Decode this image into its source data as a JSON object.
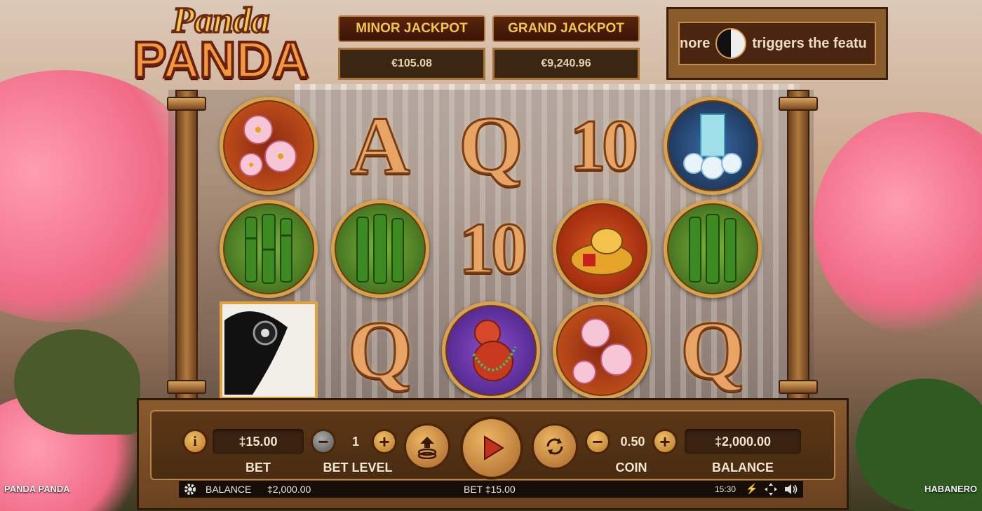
{
  "game": {
    "logo_line1": "Panda",
    "logo_line2": "PANDA",
    "corner_title": "PANDA PANDA",
    "provider": "HABANERO"
  },
  "jackpots": {
    "minor": {
      "label": "MINOR JACKPOT",
      "value": "€105.08"
    },
    "grand": {
      "label": "GRAND JACKPOT",
      "value": "€9,240.96"
    }
  },
  "info_ticker": {
    "text_before": "nore",
    "text_after": "triggers the featu",
    "icon": "yin-yang-panda-icon"
  },
  "reels": [
    [
      "cherry-blossom",
      "bamboo",
      "panda"
    ],
    [
      "A",
      "bamboo",
      "Q"
    ],
    [
      "Q",
      "10",
      "gourd"
    ],
    [
      "10",
      "gold-ingot",
      "cherry-blossom"
    ],
    [
      "waterfall",
      "bamboo",
      "Q"
    ]
  ],
  "controls": {
    "bet_value": "‡15.00",
    "bet_label": "BET",
    "bet_level_value": "1",
    "bet_level_label": "BET LEVEL",
    "coin_value": "0.50",
    "coin_label": "COIN",
    "balance_value": "‡2,000.00",
    "balance_label": "BALANCE",
    "minus": "−",
    "plus": "+",
    "info": "i"
  },
  "status_bar": {
    "balance_label": "BALANCE",
    "balance_value": "‡2,000.00",
    "bet_text": "BET ‡15.00",
    "time": "15:30"
  },
  "colors": {
    "accent": "#f4c548",
    "wood": "#6a4220",
    "text": "#f4e8d2"
  }
}
